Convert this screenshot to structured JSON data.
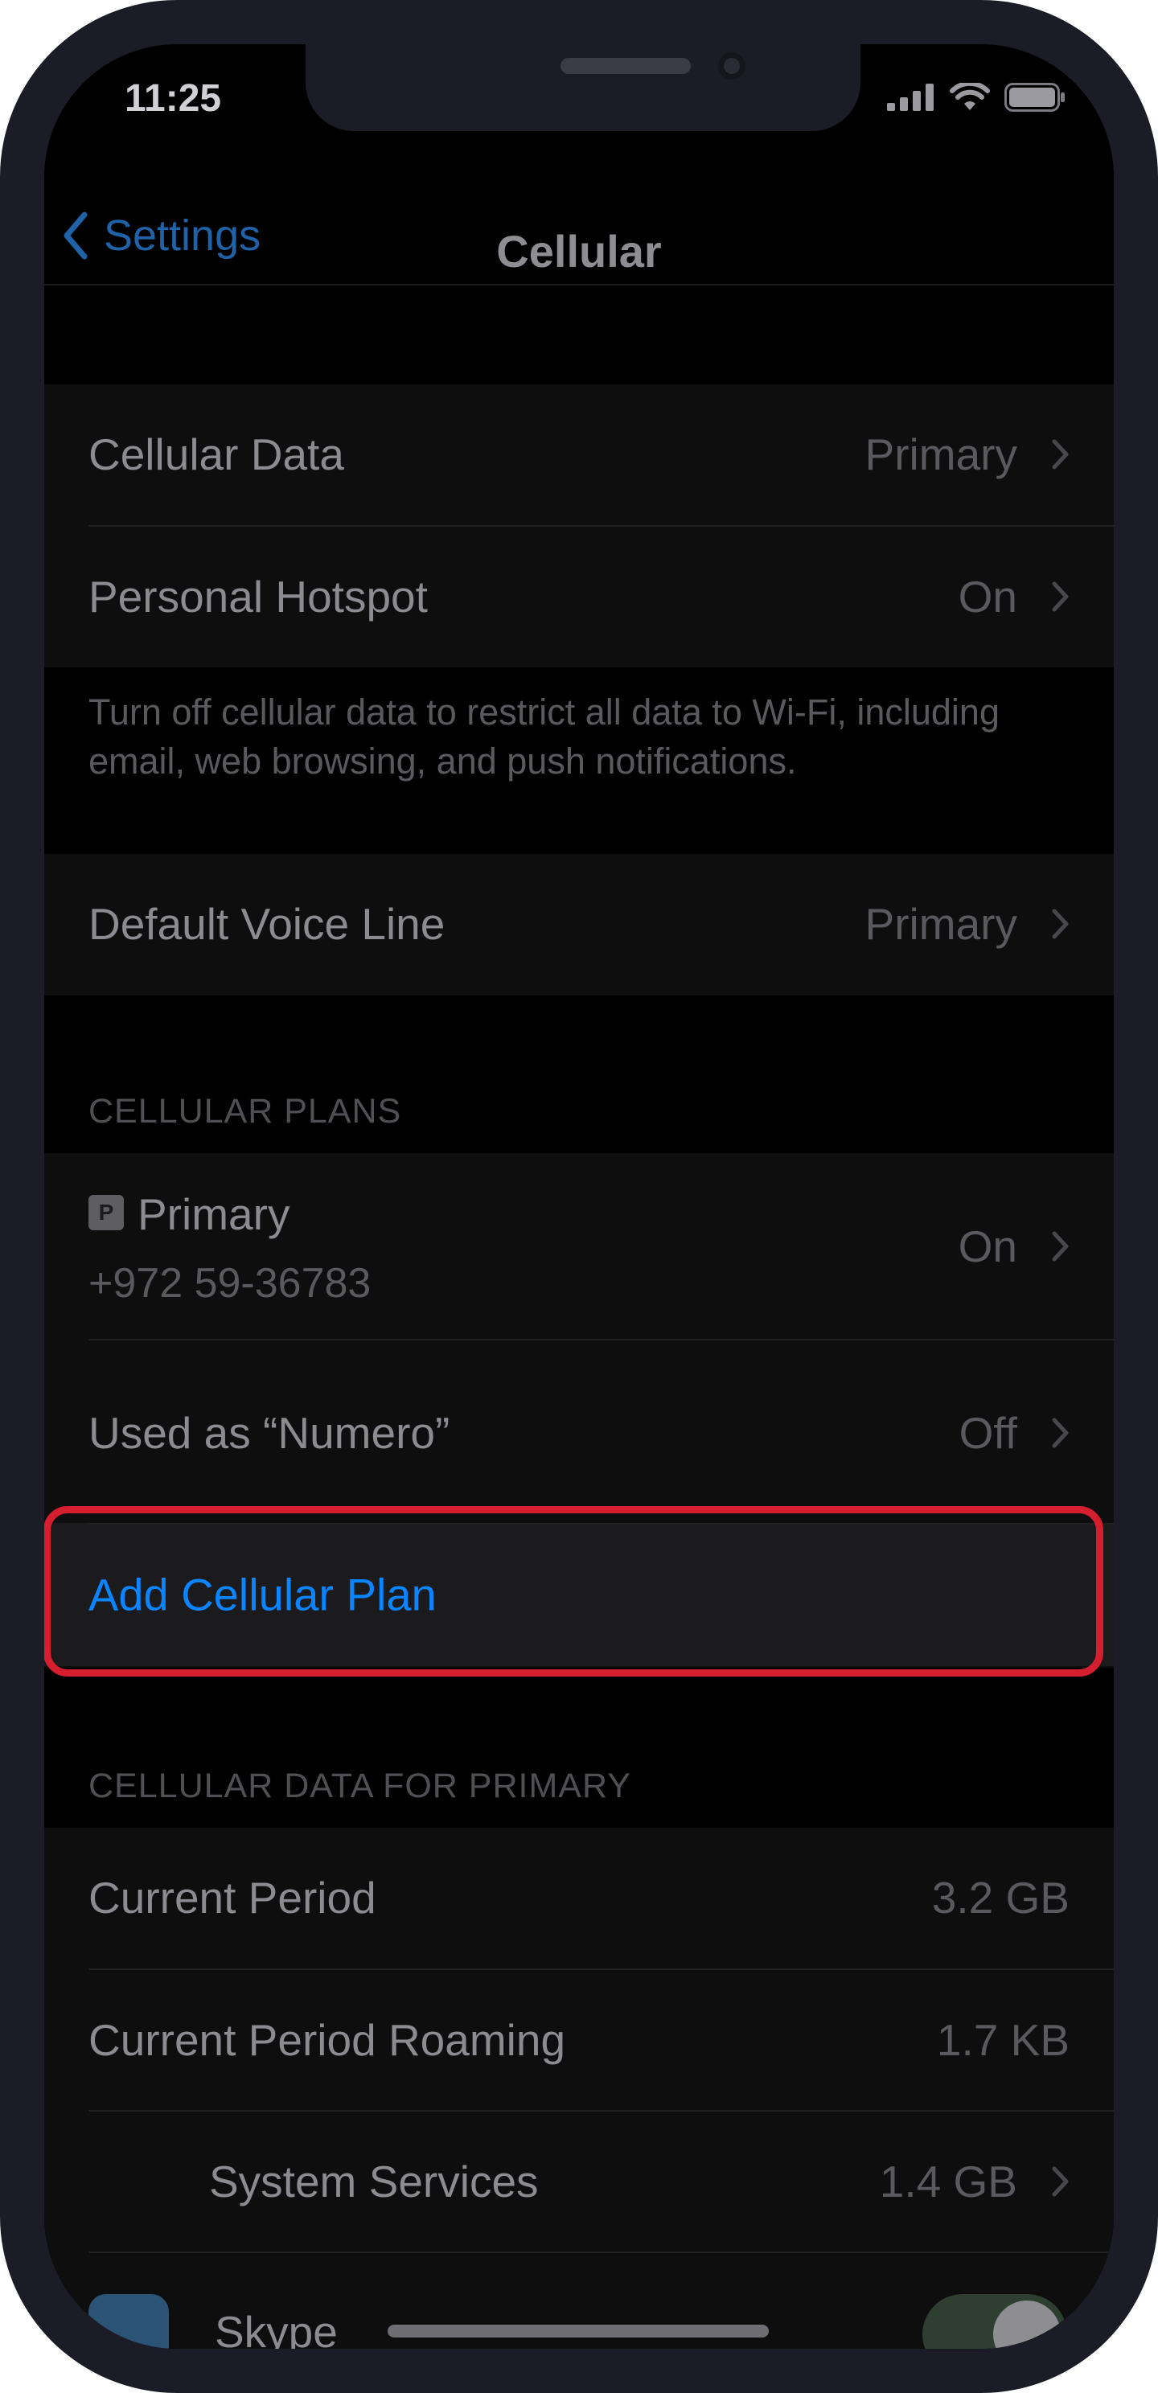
{
  "status_bar": {
    "time": "11:25"
  },
  "nav": {
    "back_label": "Settings",
    "title": "Cellular"
  },
  "group1": {
    "cellular_data": {
      "label": "Cellular Data",
      "value": "Primary"
    },
    "personal_hotspot": {
      "label": "Personal Hotspot",
      "value": "On"
    },
    "footnote": "Turn off cellular data to restrict all data to Wi-Fi, including email, web browsing, and push notifications."
  },
  "group2": {
    "default_voice_line": {
      "label": "Default Voice Line",
      "value": "Primary"
    }
  },
  "cellular_plans": {
    "header": "CELLULAR PLANS",
    "primary": {
      "badge": "P",
      "name": "Primary",
      "number": "+972 59-36783",
      "value": "On"
    },
    "used_as": {
      "label": "Used as “Numero”",
      "value": "Off"
    },
    "add_plan": "Add Cellular Plan"
  },
  "cellular_data_for_primary": {
    "header": "CELLULAR DATA FOR PRIMARY",
    "current_period": {
      "label": "Current Period",
      "value": "3.2 GB"
    },
    "current_period_roaming": {
      "label": "Current Period Roaming",
      "value": "1.7 KB"
    },
    "system_services": {
      "label": "System Services",
      "value": "1.4 GB"
    },
    "skype": {
      "label": "Skype"
    }
  },
  "colors": {
    "accent_blue": "#0a84ff",
    "highlight_red": "#d61f2e"
  }
}
